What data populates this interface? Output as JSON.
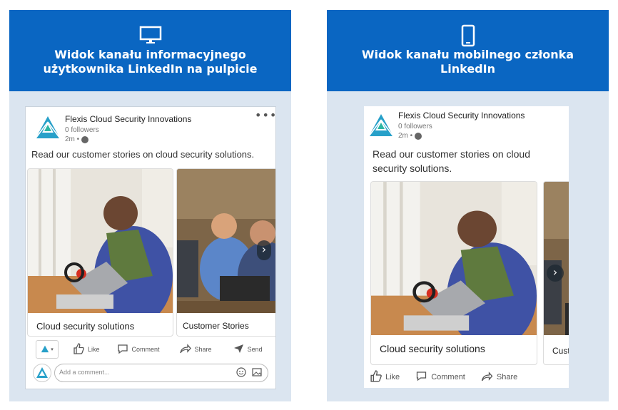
{
  "desktop": {
    "banner_title": "Widok kanału informacyjnego użytkownika LinkedIn na pulpicie",
    "company": "Flexis Cloud Security Innovations",
    "followers": "0 followers",
    "time": "2m •",
    "post_text": "Read our customer stories on cloud security solutions.",
    "slides": [
      {
        "caption": "Cloud security solutions"
      },
      {
        "caption": "Customer Stories"
      }
    ],
    "actions": {
      "like": "Like",
      "comment": "Comment",
      "share": "Share",
      "send": "Send"
    },
    "comment_placeholder": "Add a comment..."
  },
  "mobile": {
    "banner_title": "Widok kanału mobilnego członka LinkedIn",
    "company": "Flexis Cloud Security Innovations",
    "followers": "0 followers",
    "time": "2m •",
    "post_text": "Read our customer stories on cloud security solutions.",
    "slides": [
      {
        "caption": "Cloud security solutions"
      },
      {
        "caption": "Cust"
      }
    ],
    "actions": {
      "like": "Like",
      "comment": "Comment",
      "share": "Share"
    }
  },
  "colors": {
    "brand_blue": "#0a66c2",
    "panel_bg": "#dbe5f0"
  }
}
